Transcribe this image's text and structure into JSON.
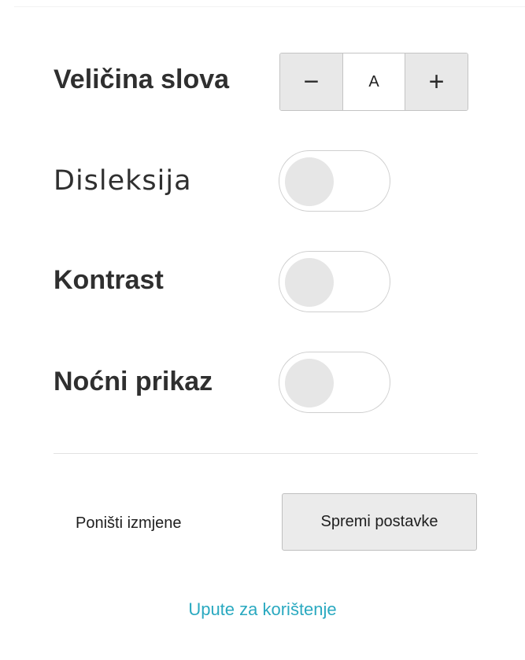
{
  "settings": {
    "font_size": {
      "label": "Veličina slova",
      "decrease_symbol": "−",
      "value_symbol": "A",
      "increase_symbol": "+"
    },
    "dyslexia": {
      "label": "Disleksija",
      "enabled": false
    },
    "contrast": {
      "label": "Kontrast",
      "enabled": false
    },
    "night_mode": {
      "label": "Noćni prikaz",
      "enabled": false
    }
  },
  "actions": {
    "reset_label": "Poništi izmjene",
    "save_label": "Spremi postavke"
  },
  "help": {
    "link_label": "Upute za korištenje"
  },
  "colors": {
    "link": "#2aa9c0",
    "label_text": "#2f2f2f",
    "toggle_knob": "#e6e6e6",
    "button_bg": "#ebebeb"
  }
}
